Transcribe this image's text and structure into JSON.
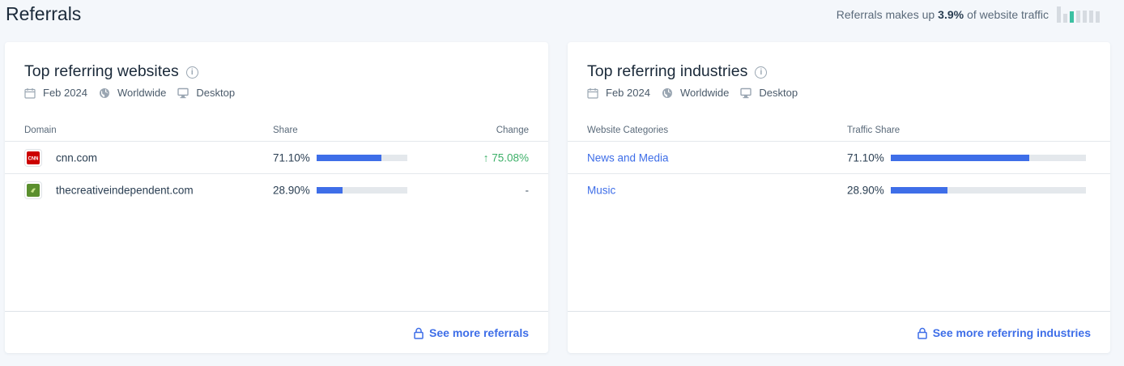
{
  "page": {
    "title": "Referrals",
    "summary_prefix": "Referrals makes up",
    "summary_value": "3.9%",
    "summary_suffix": "of website traffic",
    "mini_bar_levels": [
      1.0,
      0.55,
      0.7,
      0.75,
      0.75,
      0.75,
      0.7
    ],
    "mini_bar_active_index": 2
  },
  "websites": {
    "title": "Top referring websites",
    "date": "Feb 2024",
    "region": "Worldwide",
    "device": "Desktop",
    "columns": {
      "domain": "Domain",
      "share": "Share",
      "change": "Change"
    },
    "rows": [
      {
        "domain": "cnn.com",
        "share": "71.10%",
        "share_fraction": 0.711,
        "change": "75.08%",
        "change_arrow": "↑",
        "favicon": "cnn-logo-icon",
        "favicon_text": "CNN"
      },
      {
        "domain": "thecreativeindependent.com",
        "share": "28.90%",
        "share_fraction": 0.289,
        "change": "-",
        "change_arrow": "",
        "favicon": "creative-independent-logo-icon"
      }
    ],
    "footer_link": "See more referrals"
  },
  "industries": {
    "title": "Top referring industries",
    "date": "Feb 2024",
    "region": "Worldwide",
    "device": "Desktop",
    "columns": {
      "category": "Website Categories",
      "share": "Traffic Share"
    },
    "rows": [
      {
        "category": "News and Media",
        "share": "71.10%",
        "share_fraction": 0.711
      },
      {
        "category": "Music",
        "share": "28.90%",
        "share_fraction": 0.289
      }
    ],
    "footer_link": "See more referring industries"
  },
  "colors": {
    "accent": "#3e6ee8",
    "positive": "#3fb16a",
    "mini_bar_active": "#3cc0a2"
  }
}
